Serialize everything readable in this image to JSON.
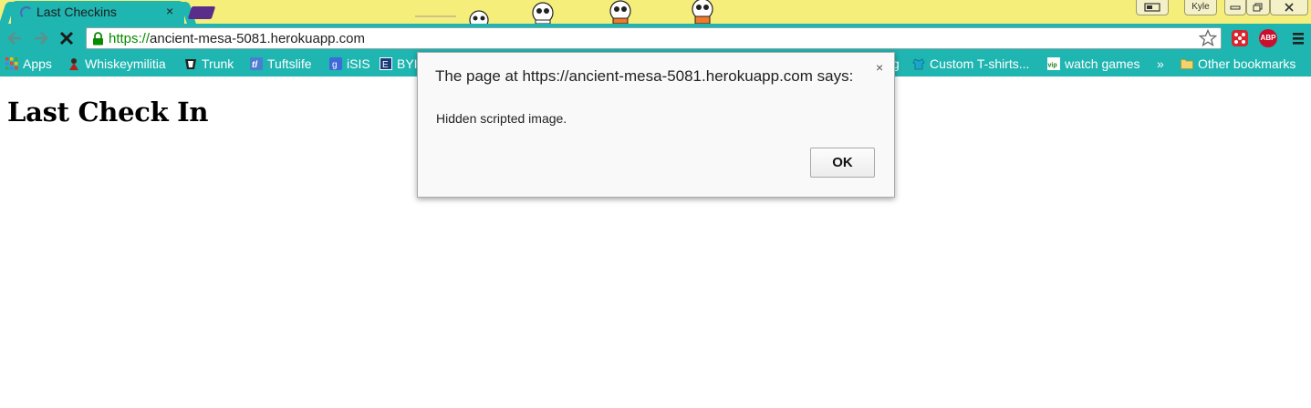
{
  "browser": {
    "tab": {
      "title": "Last Checkins",
      "close": "×"
    },
    "profile_name": "Kyle",
    "address": {
      "scheme": "https://",
      "host": "ancient-mesa-5081.herokuapp.com"
    },
    "toolbar_icons": [
      "back-arrow-icon",
      "forward-arrow-icon",
      "stop-icon",
      "lock-icon",
      "star-icon",
      "extension-dice-icon",
      "adblock-plus-icon",
      "menu-icon"
    ],
    "abp_label": "ABP",
    "accent_color": "#1fb5b0",
    "theme_color": "#f6ee7a"
  },
  "bookmarks": {
    "items": [
      {
        "label": "Apps",
        "icon": "apps-grid-icon"
      },
      {
        "label": "Whiskeymilitia",
        "icon": "whiskeymilitia-icon"
      },
      {
        "label": "Trunk",
        "icon": "trunk-icon"
      },
      {
        "label": "Tuftslife",
        "icon": "tuftslife-icon"
      },
      {
        "label": "iSIS",
        "icon": "isis-icon"
      },
      {
        "label": "BYI",
        "icon": "byi-icon"
      },
      {
        "label": "g",
        "icon": ""
      },
      {
        "label": "Custom T-shirts...",
        "icon": "custom-tshirts-icon"
      },
      {
        "label": "watch games",
        "icon": "vip-icon"
      }
    ],
    "overflow": "»",
    "other": "Other bookmarks"
  },
  "page": {
    "heading": "Last Check In"
  },
  "dialog": {
    "title": "The page at https://ancient-mesa-5081.herokuapp.com says:",
    "message": "Hidden scripted image.",
    "close": "×",
    "ok_label": "OK"
  }
}
